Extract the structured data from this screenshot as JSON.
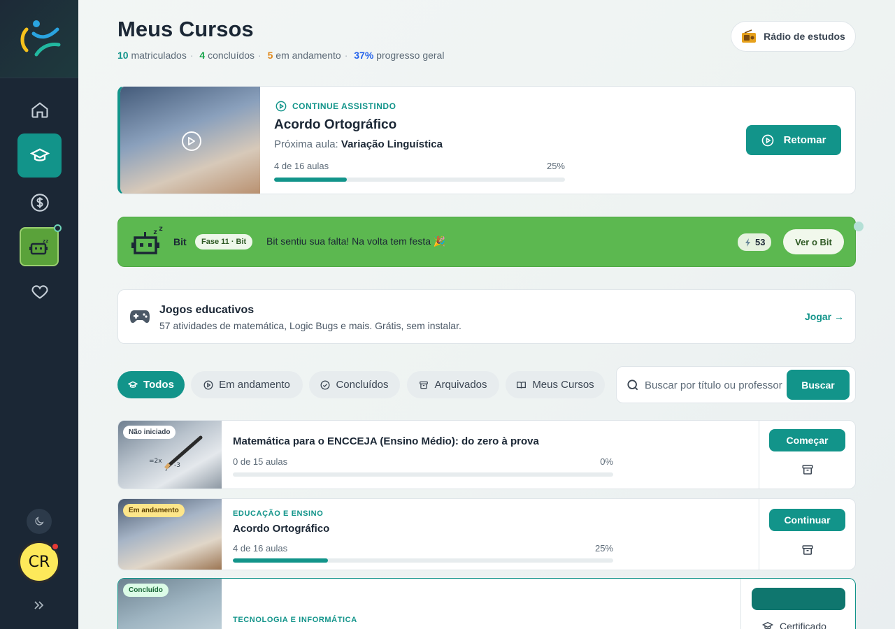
{
  "header": {
    "title": "Meus Cursos",
    "stats": {
      "enrolled_count": "10",
      "enrolled_label": "matriculados",
      "completed_count": "4",
      "completed_label": "concluídos",
      "progress_count": "5",
      "progress_label": "em andamento",
      "overall_value": "37%",
      "overall_label": "progresso geral"
    },
    "radio_label": "Rádio de estudos"
  },
  "sidebar": {
    "items": [
      {
        "name": "home",
        "icon": "home-icon"
      },
      {
        "name": "courses",
        "icon": "graduation-cap-icon",
        "active": true
      },
      {
        "name": "finance",
        "icon": "dollar-icon"
      },
      {
        "name": "bit",
        "icon": "robot-icon"
      },
      {
        "name": "favorites",
        "icon": "heart-icon"
      }
    ],
    "avatar_initials": "CR"
  },
  "continue_watching": {
    "label": "CONTINUE ASSISTINDO",
    "title": "Acordo Ortográfico",
    "next_prefix": "Próxima aula:",
    "next_lesson": "Variação Linguística",
    "progress_text": "4 de 16 aulas",
    "progress_percent": "25%",
    "progress_value": 0.25,
    "resume_label": "Retomar"
  },
  "bit_banner": {
    "name": "Bit",
    "phase": "Fase 11 · Bit",
    "message": "Bit sentiu sua falta! Na volta tem festa 🎉",
    "count": "53",
    "see_label": "Ver o Bit"
  },
  "games": {
    "title": "Jogos educativos",
    "description": "57 atividades de matemática, Logic Bugs e mais. Grátis, sem instalar.",
    "play_label": "Jogar →"
  },
  "filters": [
    {
      "label": "Todos",
      "icon": "graduation-cap-icon",
      "active": true
    },
    {
      "label": "Em andamento",
      "icon": "play-circle-icon"
    },
    {
      "label": "Concluídos",
      "icon": "check-circle-icon"
    },
    {
      "label": "Arquivados",
      "icon": "archive-icon"
    },
    {
      "label": "Meus Cursos",
      "icon": "book-open-icon"
    }
  ],
  "search": {
    "placeholder": "Buscar por título ou professor",
    "button_label": "Buscar"
  },
  "courses": [
    {
      "status": "Não iniciado",
      "category": "",
      "title": "Matemática para o ENCCEJA (Ensino Médio): do zero à prova",
      "progress_text": "0 de 15 aulas",
      "progress_percent": "0%",
      "progress_value": 0,
      "action_label": "Começar"
    },
    {
      "status": "Em andamento",
      "category": "EDUCAÇÃO E ENSINO",
      "title": "Acordo Ortográfico",
      "progress_text": "4 de 16 aulas",
      "progress_percent": "25%",
      "progress_value": 0.25,
      "action_label": "Continuar"
    },
    {
      "status": "Concluído",
      "category": "TECNOLOGIA E INFORMÁTICA",
      "title": "",
      "certificate_label": "Certificado"
    }
  ],
  "colors": {
    "accent": "#12948a",
    "sidebar": "#1b2735",
    "bit_green": "#5cb850",
    "enrolled": "#12948a",
    "completed": "#17a34a",
    "in_progress": "#e08a1e",
    "overall": "#2563eb"
  }
}
